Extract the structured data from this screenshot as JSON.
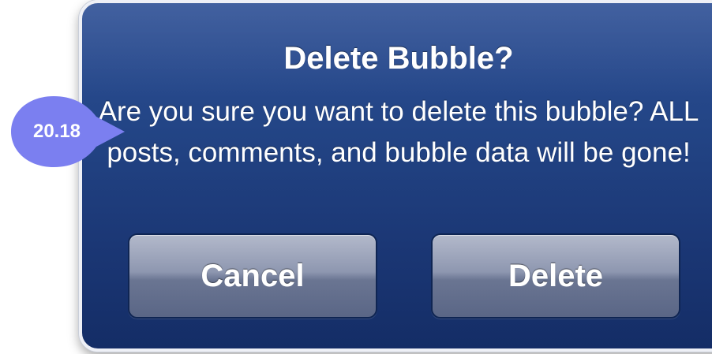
{
  "dialog": {
    "title": "Delete Bubble?",
    "message": "Are you sure you want to delete this bubble? ALL posts, comments, and bubble data will be gone!",
    "cancel_label": "Cancel",
    "delete_label": "Delete"
  },
  "badge": {
    "value": "20.18",
    "color": "#7b7ff0"
  },
  "colors": {
    "dialog_top": "#2d4f95",
    "dialog_bottom": "#142d66",
    "button_top": "#b3b9cb",
    "button_bottom": "#5a6686"
  }
}
